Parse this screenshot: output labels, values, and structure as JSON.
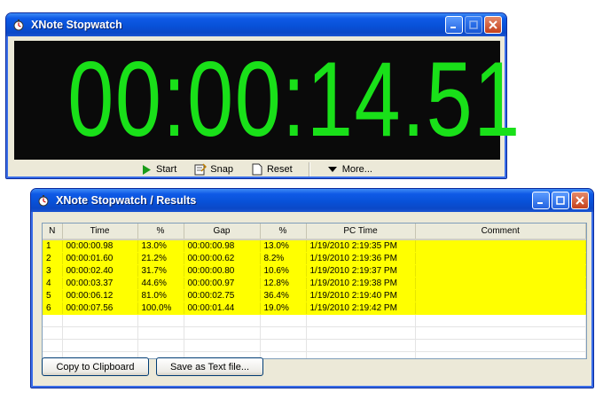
{
  "stopwatch": {
    "title": "XNote Stopwatch",
    "time": "00:00:14.51",
    "toolbar": {
      "start": "Start",
      "snap": "Snap",
      "reset": "Reset",
      "more": "More..."
    },
    "digit_color": "#19e019"
  },
  "results": {
    "title": "XNote Stopwatch / Results",
    "columns": [
      "N",
      "Time",
      "%",
      "Gap",
      "%",
      "PC Time",
      "Comment"
    ],
    "rows": [
      [
        "1",
        "00:00:00.98",
        "13.0%",
        "00:00:00.98",
        "13.0%",
        "1/19/2010 2:19:35 PM",
        ""
      ],
      [
        "2",
        "00:00:01.60",
        "21.2%",
        "00:00:00.62",
        "8.2%",
        "1/19/2010 2:19:36 PM",
        ""
      ],
      [
        "3",
        "00:00:02.40",
        "31.7%",
        "00:00:00.80",
        "10.6%",
        "1/19/2010 2:19:37 PM",
        ""
      ],
      [
        "4",
        "00:00:03.37",
        "44.6%",
        "00:00:00.97",
        "12.8%",
        "1/19/2010 2:19:38 PM",
        ""
      ],
      [
        "5",
        "00:00:06.12",
        "81.0%",
        "00:00:02.75",
        "36.4%",
        "1/19/2010 2:19:40 PM",
        ""
      ],
      [
        "6",
        "00:00:07.56",
        "100.0%",
        "00:00:01.44",
        "19.0%",
        "1/19/2010 2:19:42 PM",
        ""
      ]
    ],
    "empty_rows": 4,
    "buttons": {
      "copy": "Copy to Clipboard",
      "save": "Save as Text file..."
    },
    "highlight_color": "#ffff00"
  }
}
